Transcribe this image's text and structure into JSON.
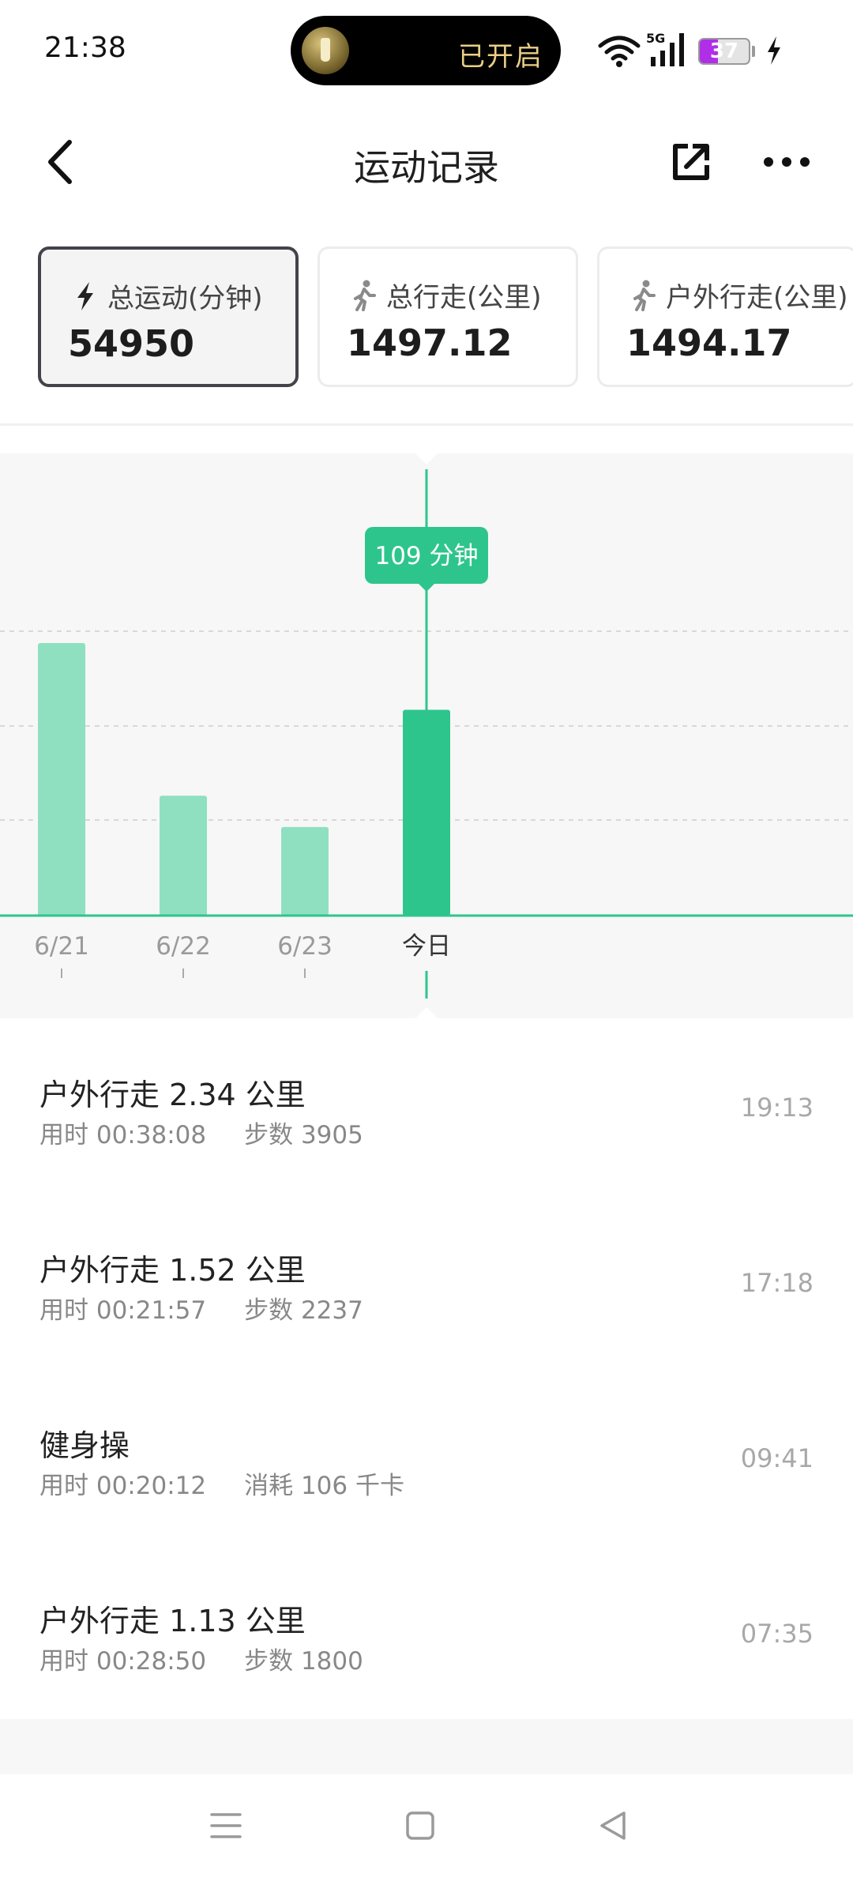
{
  "status_bar": {
    "time": "21:38",
    "island_text": "已开启",
    "network_label": "5G",
    "battery_level": "37",
    "battery_fraction": 0.37,
    "charging": true
  },
  "header": {
    "title": "运动记录",
    "back_icon": "chevron-left-icon",
    "share_icon": "share-external-icon",
    "more_icon": "more-horizontal-icon"
  },
  "stat_cards": [
    {
      "icon": "bolt-icon",
      "label": "总运动(分钟)",
      "value": "54950",
      "active": true
    },
    {
      "icon": "walk-icon",
      "label": "总行走(公里)",
      "value": "1497.12",
      "active": false
    },
    {
      "icon": "walk-icon",
      "label": "户外行走(公里)",
      "value": "1494.17",
      "active": false
    }
  ],
  "chart_data": {
    "type": "bar",
    "categories": [
      "6/21",
      "6/22",
      "6/23",
      "今日"
    ],
    "values": [
      200,
      88,
      65,
      151
    ],
    "selected_index": 3,
    "tooltip": "109 分钟",
    "grid": true,
    "colors": {
      "bar": "#8ee0c0",
      "bar_selected": "#2ec58d",
      "line": "#2ec58d",
      "tooltip_bg": "#2ec58d"
    }
  },
  "activities": [
    {
      "title": "户外行走 2.34 公里",
      "meta_a": "用时 00:38:08",
      "meta_b": "步数 3905",
      "time": "19:13"
    },
    {
      "title": "户外行走 1.52 公里",
      "meta_a": "用时 00:21:57",
      "meta_b": "步数 2237",
      "time": "17:18"
    },
    {
      "title": "健身操",
      "meta_a": "用时 00:20:12",
      "meta_b": "消耗 106 千卡",
      "time": "09:41"
    },
    {
      "title": "户外行走 1.13 公里",
      "meta_a": "用时 00:28:50",
      "meta_b": "步数 1800",
      "time": "07:35"
    }
  ],
  "nav_bar": {
    "menu_icon": "menu-icon",
    "home_icon": "home-square-icon",
    "back_icon": "back-triangle-icon"
  }
}
